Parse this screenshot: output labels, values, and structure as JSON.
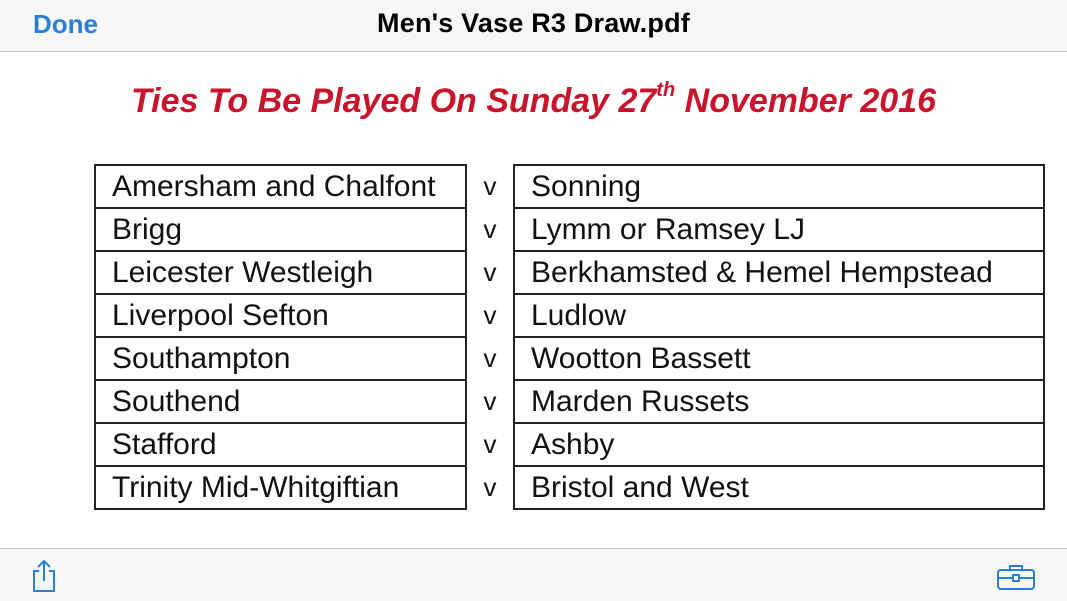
{
  "navbar": {
    "done_label": "Done",
    "title": "Men's Vase R3 Draw.pdf"
  },
  "document": {
    "heading_before": "Ties To Be Played On Sunday 27",
    "heading_sup": "th",
    "heading_after": " November 2016",
    "separator": "v",
    "fixtures": [
      {
        "home": "Amersham and Chalfont",
        "away": "Sonning"
      },
      {
        "home": "Brigg",
        "away": "Lymm or Ramsey LJ"
      },
      {
        "home": "Leicester Westleigh",
        "away": "Berkhamsted & Hemel Hempstead"
      },
      {
        "home": "Liverpool Sefton",
        "away": "Ludlow"
      },
      {
        "home": "Southampton",
        "away": "Wootton Bassett"
      },
      {
        "home": "Southend",
        "away": "Marden Russets"
      },
      {
        "home": "Stafford",
        "away": "Ashby"
      },
      {
        "home": "Trinity Mid-Whitgiftian",
        "away": "Bristol and West"
      }
    ]
  },
  "toolbar": {
    "share_icon": "share-icon",
    "tools_icon": "toolbox-icon"
  },
  "colors": {
    "accent": "#2c7fd6",
    "heading": "#c9142c"
  }
}
